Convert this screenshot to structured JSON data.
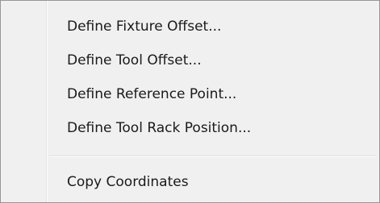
{
  "context_menu": {
    "items": [
      {
        "label": "Define Fixture Offset..."
      },
      {
        "label": "Define Tool Offset..."
      },
      {
        "label": "Define Reference Point..."
      },
      {
        "label": "Define Tool Rack Position..."
      }
    ],
    "secondary_items": [
      {
        "label": "Copy Coordinates"
      }
    ]
  }
}
